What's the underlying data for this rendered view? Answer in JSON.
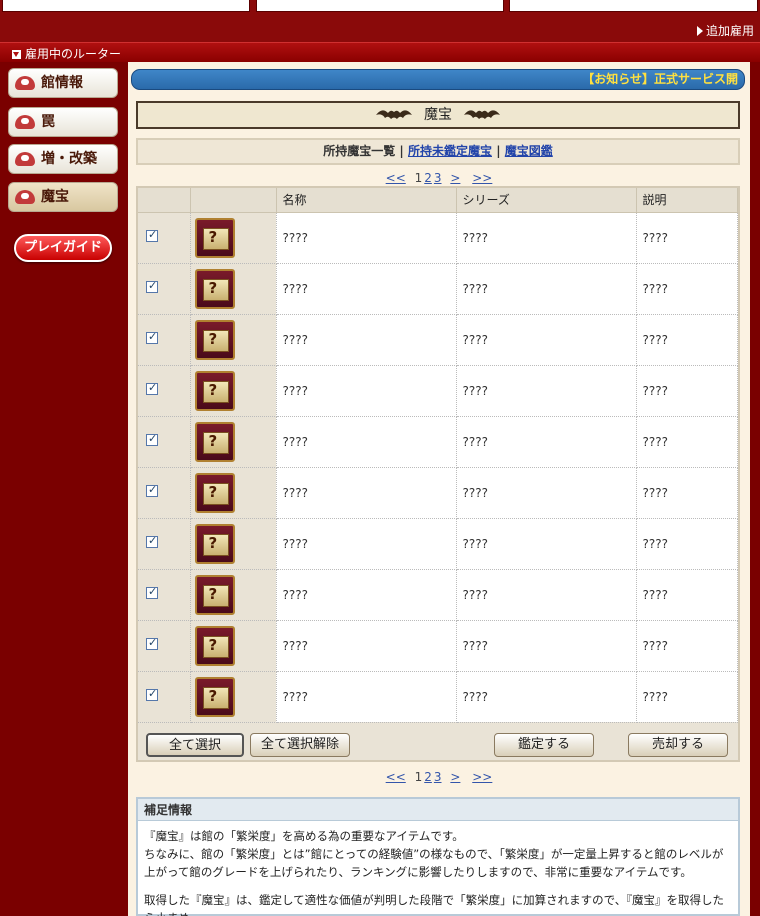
{
  "top": {
    "add_employ": "追加雇用"
  },
  "section": {
    "title": "雇用中のルーター"
  },
  "sidebar": {
    "items": [
      {
        "label": "館情報"
      },
      {
        "label": "罠"
      },
      {
        "label": "増・改築"
      },
      {
        "label": "魔宝"
      }
    ],
    "guide": "プレイガイド"
  },
  "news": {
    "text": "【お知らせ】正式サービス開"
  },
  "page": {
    "title": "魔宝"
  },
  "subnav": {
    "current": "所持魔宝一覧",
    "link1": "所持未鑑定魔宝",
    "link2": "魔宝図鑑",
    "sep": "|"
  },
  "pager": {
    "first": "<<",
    "pages": [
      "1",
      "2",
      "3"
    ],
    "next": ">",
    "last": ">>"
  },
  "table": {
    "headers": [
      "名称",
      "シリーズ",
      "説明"
    ],
    "rows": [
      {
        "checked": true,
        "name": "????",
        "series": "????",
        "desc": "????"
      },
      {
        "checked": true,
        "name": "????",
        "series": "????",
        "desc": "????"
      },
      {
        "checked": true,
        "name": "????",
        "series": "????",
        "desc": "????"
      },
      {
        "checked": true,
        "name": "????",
        "series": "????",
        "desc": "????"
      },
      {
        "checked": true,
        "name": "????",
        "series": "????",
        "desc": "????"
      },
      {
        "checked": true,
        "name": "????",
        "series": "????",
        "desc": "????"
      },
      {
        "checked": true,
        "name": "????",
        "series": "????",
        "desc": "????"
      },
      {
        "checked": true,
        "name": "????",
        "series": "????",
        "desc": "????"
      },
      {
        "checked": true,
        "name": "????",
        "series": "????",
        "desc": "????"
      },
      {
        "checked": true,
        "name": "????",
        "series": "????",
        "desc": "????"
      }
    ]
  },
  "buttons": {
    "select_all": "全て選択",
    "deselect_all": "全て選択解除",
    "appraise": "鑑定する",
    "sell": "売却する"
  },
  "info": {
    "title": "補足情報",
    "line1": "『魔宝』は館の「繁栄度」を高める為の重要なアイテムです。",
    "line2": "ちなみに、館の「繁栄度」とは”館にとっての経験値”の様なもので、「繁栄度」が一定量上昇すると館のレベルが上がって館のグレードを上げられたり、ランキングに影響したりしますので、非常に重要なアイテムです。",
    "line3": "取得した『魔宝』は、鑑定して適性な価値が判明した段階で「繁栄度」に加算されますので、『魔宝』を取得したら小まめ"
  },
  "colors": {
    "frame": "#7a0000",
    "news_bg": "#3f86c8",
    "news_text": "#ffe040",
    "link": "#2244aa"
  }
}
